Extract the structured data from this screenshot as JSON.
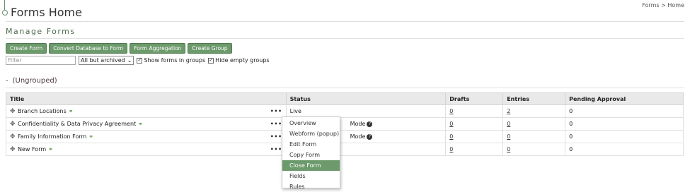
{
  "header": {
    "title": "Forms Home",
    "breadcrumb": "Forms > Home"
  },
  "section": {
    "title": "Manage Forms"
  },
  "toolbar": {
    "buttons": [
      "Create Form",
      "Convert Database to Form",
      "Form Aggregation",
      "Create Group"
    ]
  },
  "filters": {
    "filter_placeholder": "Filter",
    "archive_select": "All but archived",
    "show_in_groups": "Show forms in groups",
    "hide_empty_groups": "Hide empty groups"
  },
  "group": {
    "toggle": "-",
    "name": "(Ungrouped)"
  },
  "table": {
    "columns": [
      "Title",
      "Status",
      "Drafts",
      "Entries",
      "Pending Approval"
    ],
    "rows": [
      {
        "title": "Branch Locations",
        "status": "Live",
        "drafts": "0",
        "entries": "2",
        "pending": "0"
      },
      {
        "title": "Confidentiality & Data Privacy Agreement",
        "status": "Mode",
        "drafts": "0",
        "entries": "0",
        "pending": "0"
      },
      {
        "title": "Family Information Form",
        "status": "Mode",
        "drafts": "0",
        "entries": "0",
        "pending": "0"
      },
      {
        "title": "New Form",
        "status": "",
        "drafts": "0",
        "entries": "0",
        "pending": "0"
      }
    ]
  },
  "context_menu": {
    "items": [
      "Overview",
      "Webform (popup)",
      "Edit Form",
      "Copy Form",
      "Close Form",
      "Fields",
      "Rules"
    ],
    "active": "Close Form"
  },
  "colors": {
    "accent": "#6c9a6c",
    "header_bg": "#e9e9e9"
  }
}
